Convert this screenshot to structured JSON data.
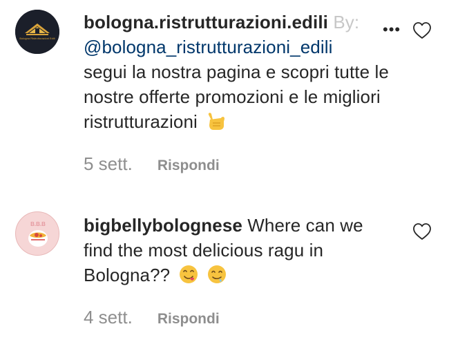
{
  "comments": [
    {
      "username": "bologna.ristrutturazioni.edili",
      "faded_tail": "By:",
      "mention": "@bologna_ristrutturazioni_edili",
      "text": "segui la nostra pagina e scopri tutte le nostre offerte promozioni e le migliori ristrutturazioni",
      "emojis": [
        "call-me-hand-emoji"
      ],
      "time": "5 sett.",
      "reply_label": "Rispondi",
      "more_label": "•••",
      "avatar_text": "Bologna Ristrutturazioni Edili"
    },
    {
      "username": "bigbellybolognese",
      "text": "Where can we find the most delicious ragu in Bologna??",
      "emojis": [
        "yum-face-emoji",
        "drooling-face-emoji"
      ],
      "time": "4 sett.",
      "reply_label": "Rispondi",
      "avatar_text": "B.B.B"
    }
  ],
  "colors": {
    "text": "#262626",
    "mention": "#00376b",
    "secondary": "#8e8e8e",
    "faded": "#c7c7c7"
  }
}
